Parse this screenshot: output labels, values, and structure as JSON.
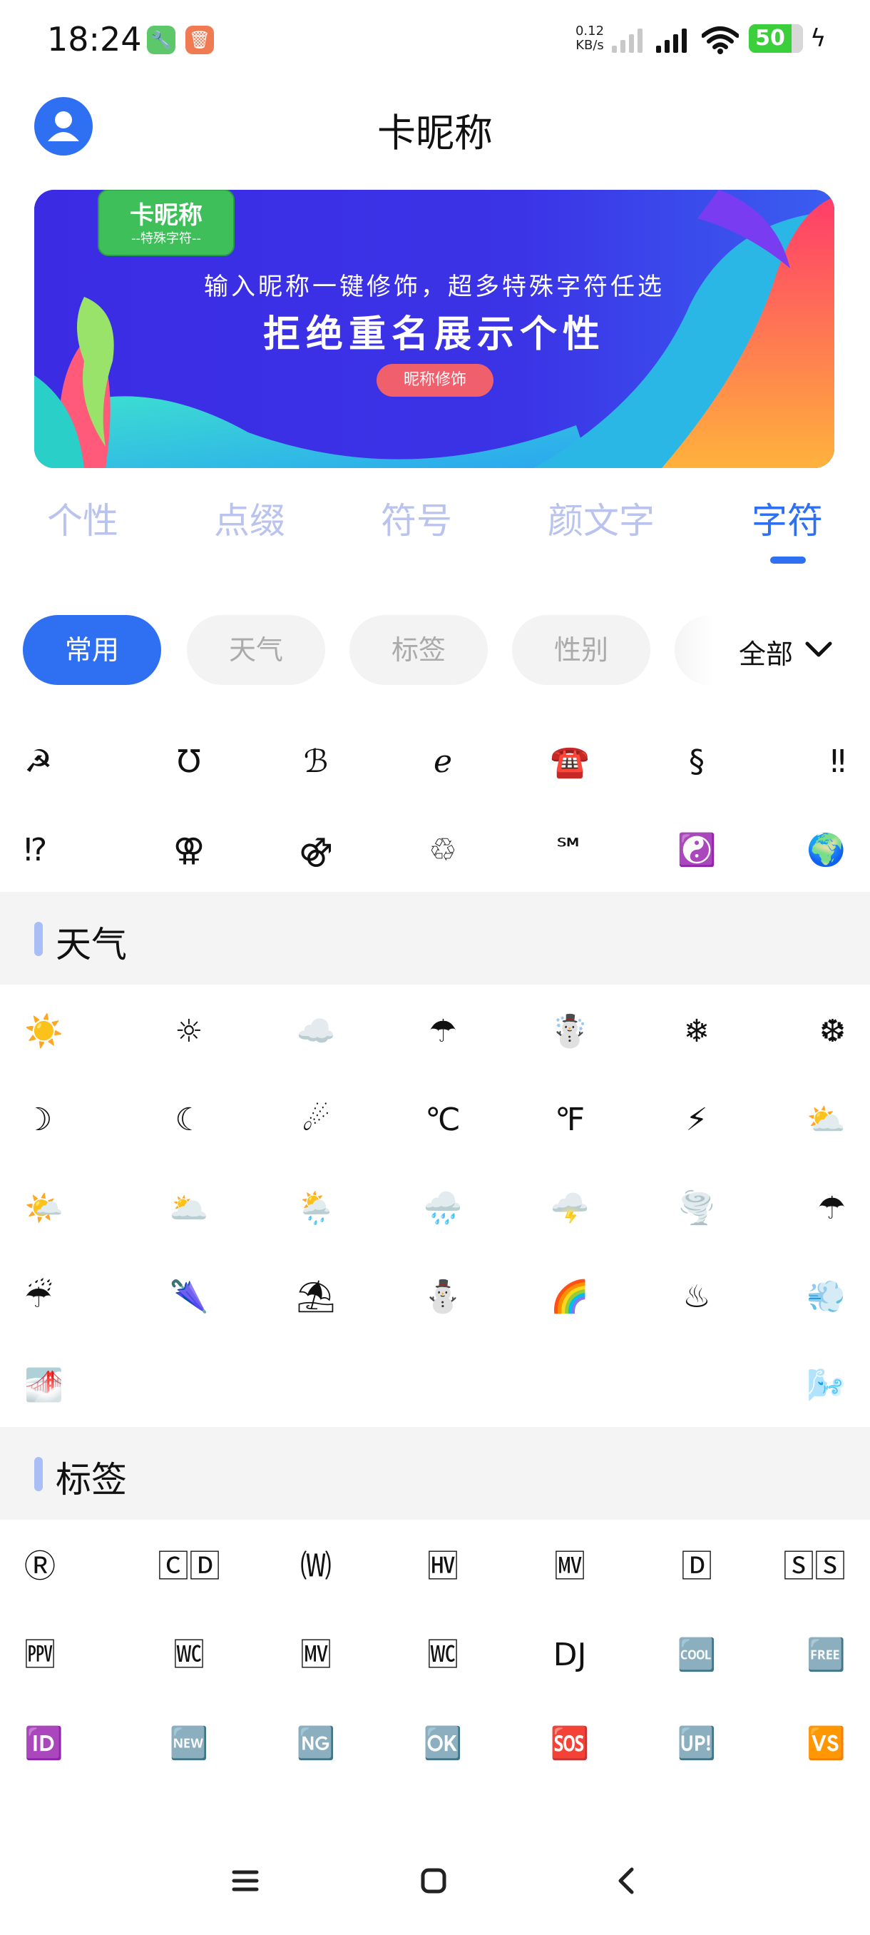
{
  "status_bar": {
    "time": "18:24",
    "netspeed_value": "0.12",
    "netspeed_unit": "KB/s",
    "battery": "50"
  },
  "header": {
    "title": "卡昵称"
  },
  "banner": {
    "badge_title": "卡昵称",
    "badge_subtitle": "--特殊字符--",
    "line1": "输入昵称一键修饰，超多特殊字符任选",
    "line2": "拒绝重名展示个性",
    "button": "昵称修饰",
    "accent_color": "#3a2fe0"
  },
  "main_tabs": [
    {
      "label": "个性",
      "active": false
    },
    {
      "label": "点缀",
      "active": false
    },
    {
      "label": "符号",
      "active": false
    },
    {
      "label": "颜文字",
      "active": false
    },
    {
      "label": "字符",
      "active": true
    }
  ],
  "chips": [
    {
      "label": "常用",
      "active": true
    },
    {
      "label": "天气",
      "active": false
    },
    {
      "label": "标签",
      "active": false
    },
    {
      "label": "性别",
      "active": false
    }
  ],
  "all_dropdown": "全部",
  "sections": {
    "common": {
      "rows": [
        [
          "☭",
          "℧",
          "ℬ",
          "ℯ",
          "☎️",
          "§",
          "‼"
        ],
        [
          "⁉",
          "⚢",
          "⚣",
          "♲",
          "℠",
          "☯️",
          "🌍"
        ]
      ]
    },
    "weather": {
      "title": "天气",
      "rows": [
        [
          "☀️",
          "☼",
          "☁️",
          "☂",
          "☃️",
          "❄",
          "❆"
        ],
        [
          "☽",
          "☾",
          "☄",
          "℃",
          "℉",
          "⚡",
          "⛅"
        ],
        [
          "🌤️",
          "🌥️",
          "🌦️",
          "🌧️",
          "🌩️",
          "🌪️",
          "☂"
        ],
        [
          "☔",
          "🌂",
          "⛱",
          "⛄",
          "🌈",
          "♨",
          "💨"
        ],
        [
          "🌁",
          "",
          "",
          "",
          "",
          "",
          "🌬️"
        ]
      ]
    },
    "tags": {
      "title": "标签",
      "rows": [
        [
          "Ⓡ",
          "🄲🄳",
          "🄦",
          "🅊",
          "🅋",
          "🄳",
          "🅂🅂"
        ],
        [
          "🅎",
          "🅏",
          "🅋",
          "🅏",
          "DJ",
          "🆒",
          "🆓"
        ],
        [
          "🆔",
          "🆕",
          "🆖",
          "🆗",
          "🆘",
          "🆙",
          "🆚"
        ]
      ]
    }
  }
}
